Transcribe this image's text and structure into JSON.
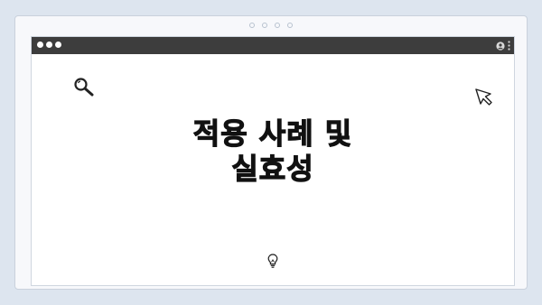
{
  "heading": {
    "line1": "적용 사례 및",
    "line2": "실효성"
  },
  "icons": {
    "search": "search-icon",
    "cursor": "cursor-icon",
    "lightbulb": "lightbulb-icon",
    "user": "user-icon",
    "menu": "more-vertical-icon"
  },
  "colors": {
    "background": "#dde5ef",
    "titlebar": "#3d3d3d",
    "window": "#ffffff",
    "text": "#111111"
  }
}
